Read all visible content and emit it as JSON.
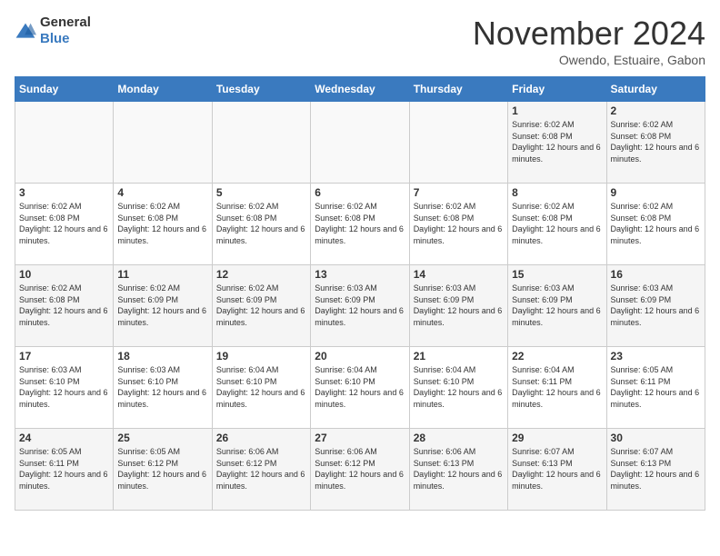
{
  "header": {
    "logo": {
      "general": "General",
      "blue": "Blue"
    },
    "title": "November 2024",
    "location": "Owendo, Estuaire, Gabon"
  },
  "calendar": {
    "days_of_week": [
      "Sunday",
      "Monday",
      "Tuesday",
      "Wednesday",
      "Thursday",
      "Friday",
      "Saturday"
    ],
    "weeks": [
      {
        "days": [
          {
            "number": "",
            "info": ""
          },
          {
            "number": "",
            "info": ""
          },
          {
            "number": "",
            "info": ""
          },
          {
            "number": "",
            "info": ""
          },
          {
            "number": "",
            "info": ""
          },
          {
            "number": "1",
            "info": "Sunrise: 6:02 AM\nSunset: 6:08 PM\nDaylight: 12 hours and 6 minutes."
          },
          {
            "number": "2",
            "info": "Sunrise: 6:02 AM\nSunset: 6:08 PM\nDaylight: 12 hours and 6 minutes."
          }
        ]
      },
      {
        "days": [
          {
            "number": "3",
            "info": "Sunrise: 6:02 AM\nSunset: 6:08 PM\nDaylight: 12 hours and 6 minutes."
          },
          {
            "number": "4",
            "info": "Sunrise: 6:02 AM\nSunset: 6:08 PM\nDaylight: 12 hours and 6 minutes."
          },
          {
            "number": "5",
            "info": "Sunrise: 6:02 AM\nSunset: 6:08 PM\nDaylight: 12 hours and 6 minutes."
          },
          {
            "number": "6",
            "info": "Sunrise: 6:02 AM\nSunset: 6:08 PM\nDaylight: 12 hours and 6 minutes."
          },
          {
            "number": "7",
            "info": "Sunrise: 6:02 AM\nSunset: 6:08 PM\nDaylight: 12 hours and 6 minutes."
          },
          {
            "number": "8",
            "info": "Sunrise: 6:02 AM\nSunset: 6:08 PM\nDaylight: 12 hours and 6 minutes."
          },
          {
            "number": "9",
            "info": "Sunrise: 6:02 AM\nSunset: 6:08 PM\nDaylight: 12 hours and 6 minutes."
          }
        ]
      },
      {
        "days": [
          {
            "number": "10",
            "info": "Sunrise: 6:02 AM\nSunset: 6:08 PM\nDaylight: 12 hours and 6 minutes."
          },
          {
            "number": "11",
            "info": "Sunrise: 6:02 AM\nSunset: 6:09 PM\nDaylight: 12 hours and 6 minutes."
          },
          {
            "number": "12",
            "info": "Sunrise: 6:02 AM\nSunset: 6:09 PM\nDaylight: 12 hours and 6 minutes."
          },
          {
            "number": "13",
            "info": "Sunrise: 6:03 AM\nSunset: 6:09 PM\nDaylight: 12 hours and 6 minutes."
          },
          {
            "number": "14",
            "info": "Sunrise: 6:03 AM\nSunset: 6:09 PM\nDaylight: 12 hours and 6 minutes."
          },
          {
            "number": "15",
            "info": "Sunrise: 6:03 AM\nSunset: 6:09 PM\nDaylight: 12 hours and 6 minutes."
          },
          {
            "number": "16",
            "info": "Sunrise: 6:03 AM\nSunset: 6:09 PM\nDaylight: 12 hours and 6 minutes."
          }
        ]
      },
      {
        "days": [
          {
            "number": "17",
            "info": "Sunrise: 6:03 AM\nSunset: 6:10 PM\nDaylight: 12 hours and 6 minutes."
          },
          {
            "number": "18",
            "info": "Sunrise: 6:03 AM\nSunset: 6:10 PM\nDaylight: 12 hours and 6 minutes."
          },
          {
            "number": "19",
            "info": "Sunrise: 6:04 AM\nSunset: 6:10 PM\nDaylight: 12 hours and 6 minutes."
          },
          {
            "number": "20",
            "info": "Sunrise: 6:04 AM\nSunset: 6:10 PM\nDaylight: 12 hours and 6 minutes."
          },
          {
            "number": "21",
            "info": "Sunrise: 6:04 AM\nSunset: 6:10 PM\nDaylight: 12 hours and 6 minutes."
          },
          {
            "number": "22",
            "info": "Sunrise: 6:04 AM\nSunset: 6:11 PM\nDaylight: 12 hours and 6 minutes."
          },
          {
            "number": "23",
            "info": "Sunrise: 6:05 AM\nSunset: 6:11 PM\nDaylight: 12 hours and 6 minutes."
          }
        ]
      },
      {
        "days": [
          {
            "number": "24",
            "info": "Sunrise: 6:05 AM\nSunset: 6:11 PM\nDaylight: 12 hours and 6 minutes."
          },
          {
            "number": "25",
            "info": "Sunrise: 6:05 AM\nSunset: 6:12 PM\nDaylight: 12 hours and 6 minutes."
          },
          {
            "number": "26",
            "info": "Sunrise: 6:06 AM\nSunset: 6:12 PM\nDaylight: 12 hours and 6 minutes."
          },
          {
            "number": "27",
            "info": "Sunrise: 6:06 AM\nSunset: 6:12 PM\nDaylight: 12 hours and 6 minutes."
          },
          {
            "number": "28",
            "info": "Sunrise: 6:06 AM\nSunset: 6:13 PM\nDaylight: 12 hours and 6 minutes."
          },
          {
            "number": "29",
            "info": "Sunrise: 6:07 AM\nSunset: 6:13 PM\nDaylight: 12 hours and 6 minutes."
          },
          {
            "number": "30",
            "info": "Sunrise: 6:07 AM\nSunset: 6:13 PM\nDaylight: 12 hours and 6 minutes."
          }
        ]
      }
    ]
  }
}
